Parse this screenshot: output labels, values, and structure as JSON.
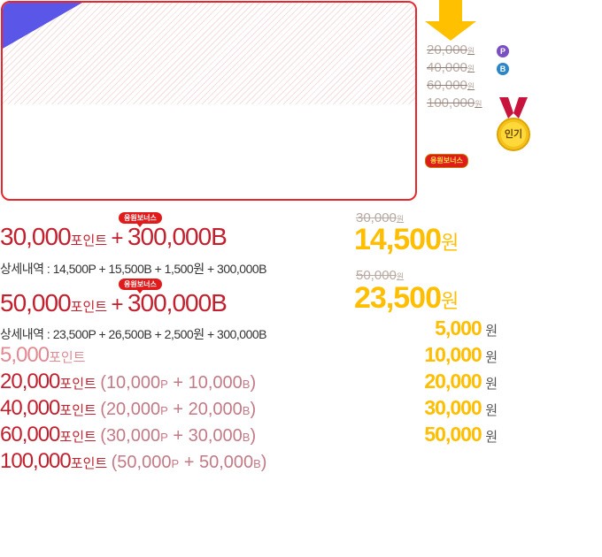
{
  "banner": {},
  "side_prices": {
    "items": [
      {
        "price": "20,000",
        "unit": "원",
        "badge": "P",
        "badge_color": "#7a4fc2"
      },
      {
        "price": "40,000",
        "unit": "원",
        "badge": "B",
        "badge_color": "#2b86c8"
      },
      {
        "price": "60,000",
        "unit": "원"
      },
      {
        "price": "100,000",
        "unit": "원"
      }
    ],
    "medal_label": "인기",
    "bonus_pill": "응원보너스"
  },
  "offers": [
    {
      "points": "30,000",
      "points_word": "포인트",
      "plus": "+",
      "bonus": "300,000B",
      "bubble": "응원보너스",
      "detail": "상세내역 : 14,500P + 15,500B + 1,500원 + 300,000B",
      "original_price": "30,000",
      "original_unit": "원",
      "price": "14,500",
      "price_unit": "원"
    },
    {
      "points": "50,000",
      "points_word": "포인트",
      "plus": "+",
      "bonus": "300,000B",
      "bubble": "응원보너스",
      "detail": "상세내역 : 23,500P + 26,500B + 2,500원 + 300,000B",
      "original_price": "50,000",
      "original_unit": "원",
      "price": "23,500",
      "price_unit": "원"
    }
  ],
  "packages": [
    {
      "points": "5,000",
      "points_word": "포인트",
      "price": "5,000",
      "unit": "원"
    },
    {
      "points": "20,000",
      "points_word": "포인트",
      "open": "(",
      "p": "10,000",
      "p_unit": "P",
      "plus": "+",
      "b": "10,000",
      "b_unit": "B",
      "close": ")",
      "price": "10,000",
      "unit": "원"
    },
    {
      "points": "40,000",
      "points_word": "포인트",
      "open": "(",
      "p": "20,000",
      "p_unit": "P",
      "plus": "+",
      "b": "20,000",
      "b_unit": "B",
      "close": ")",
      "price": "20,000",
      "unit": "원"
    },
    {
      "points": "60,000",
      "points_word": "포인트",
      "open": "(",
      "p": "30,000",
      "p_unit": "P",
      "plus": "+",
      "b": "30,000",
      "b_unit": "B",
      "close": ")",
      "price": "30,000",
      "unit": "원"
    },
    {
      "points": "100,000",
      "points_word": "포인트",
      "open": "(",
      "p": "50,000",
      "p_unit": "P",
      "plus": "+",
      "b": "50,000",
      "b_unit": "B",
      "close": ")",
      "price": "50,000",
      "unit": "원"
    }
  ]
}
